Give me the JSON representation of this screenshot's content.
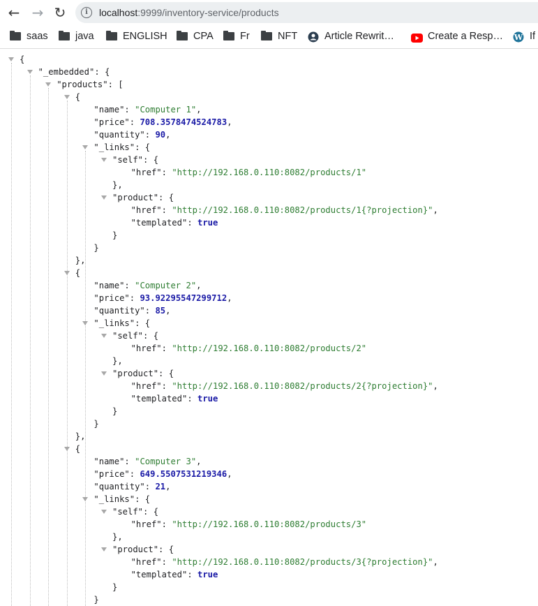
{
  "browser": {
    "nav": {
      "back_icon": "←",
      "forward_icon": "→",
      "reload_icon": "↻"
    },
    "url": {
      "host": "localhost",
      "rest": ":9999/inventory-service/products"
    },
    "bookmarks": [
      {
        "label": "saas",
        "icon": "folder-icon"
      },
      {
        "label": "java",
        "icon": "folder-icon"
      },
      {
        "label": "ENGLISH",
        "icon": "folder-icon"
      },
      {
        "label": "CPA",
        "icon": "folder-icon"
      },
      {
        "label": "Fr",
        "icon": "folder-icon"
      },
      {
        "label": "NFT",
        "icon": "folder-icon"
      },
      {
        "label": "Article Rewrit…",
        "icon": "article-rewriter-icon"
      },
      {
        "label": "Create a Resp…",
        "icon": "youtube-icon"
      },
      {
        "label": "If",
        "icon": "wordpress-icon"
      }
    ]
  },
  "json_lines": [
    {
      "indent": 0,
      "arrow": true,
      "tokens": [
        [
          "p",
          "{"
        ]
      ]
    },
    {
      "indent": 1,
      "arrow": true,
      "tokens": [
        [
          "k",
          "\"_embedded\""
        ],
        [
          "p",
          ": {"
        ]
      ]
    },
    {
      "indent": 2,
      "arrow": true,
      "tokens": [
        [
          "k",
          "\"products\""
        ],
        [
          "p",
          ": ["
        ]
      ]
    },
    {
      "indent": 3,
      "arrow": true,
      "tokens": [
        [
          "p",
          "{"
        ]
      ]
    },
    {
      "indent": 4,
      "arrow": false,
      "tokens": [
        [
          "k",
          "\"name\""
        ],
        [
          "p",
          ": "
        ],
        [
          "s",
          "\"Computer 1\""
        ],
        [
          "p",
          ","
        ]
      ]
    },
    {
      "indent": 4,
      "arrow": false,
      "tokens": [
        [
          "k",
          "\"price\""
        ],
        [
          "p",
          ": "
        ],
        [
          "n",
          "708.3578474524783"
        ],
        [
          "p",
          ","
        ]
      ]
    },
    {
      "indent": 4,
      "arrow": false,
      "tokens": [
        [
          "k",
          "\"quantity\""
        ],
        [
          "p",
          ": "
        ],
        [
          "n",
          "90"
        ],
        [
          "p",
          ","
        ]
      ]
    },
    {
      "indent": 4,
      "arrow": true,
      "tokens": [
        [
          "k",
          "\"_links\""
        ],
        [
          "p",
          ": {"
        ]
      ]
    },
    {
      "indent": 5,
      "arrow": true,
      "tokens": [
        [
          "k",
          "\"self\""
        ],
        [
          "p",
          ": {"
        ]
      ]
    },
    {
      "indent": 6,
      "arrow": false,
      "tokens": [
        [
          "k",
          "\"href\""
        ],
        [
          "p",
          ": "
        ],
        [
          "s",
          "\"http://192.168.0.110:8082/products/1\""
        ]
      ]
    },
    {
      "indent": 5,
      "arrow": false,
      "tokens": [
        [
          "p",
          "},"
        ]
      ]
    },
    {
      "indent": 5,
      "arrow": true,
      "tokens": [
        [
          "k",
          "\"product\""
        ],
        [
          "p",
          ": {"
        ]
      ]
    },
    {
      "indent": 6,
      "arrow": false,
      "tokens": [
        [
          "k",
          "\"href\""
        ],
        [
          "p",
          ": "
        ],
        [
          "s",
          "\"http://192.168.0.110:8082/products/1{?projection}\""
        ],
        [
          "p",
          ","
        ]
      ]
    },
    {
      "indent": 6,
      "arrow": false,
      "tokens": [
        [
          "k",
          "\"templated\""
        ],
        [
          "p",
          ": "
        ],
        [
          "b",
          "true"
        ]
      ]
    },
    {
      "indent": 5,
      "arrow": false,
      "tokens": [
        [
          "p",
          "}"
        ]
      ]
    },
    {
      "indent": 4,
      "arrow": false,
      "tokens": [
        [
          "p",
          "}"
        ]
      ]
    },
    {
      "indent": 3,
      "arrow": false,
      "tokens": [
        [
          "p",
          "},"
        ]
      ]
    },
    {
      "indent": 3,
      "arrow": true,
      "tokens": [
        [
          "p",
          "{"
        ]
      ]
    },
    {
      "indent": 4,
      "arrow": false,
      "tokens": [
        [
          "k",
          "\"name\""
        ],
        [
          "p",
          ": "
        ],
        [
          "s",
          "\"Computer 2\""
        ],
        [
          "p",
          ","
        ]
      ]
    },
    {
      "indent": 4,
      "arrow": false,
      "tokens": [
        [
          "k",
          "\"price\""
        ],
        [
          "p",
          ": "
        ],
        [
          "n",
          "93.92295547299712"
        ],
        [
          "p",
          ","
        ]
      ]
    },
    {
      "indent": 4,
      "arrow": false,
      "tokens": [
        [
          "k",
          "\"quantity\""
        ],
        [
          "p",
          ": "
        ],
        [
          "n",
          "85"
        ],
        [
          "p",
          ","
        ]
      ]
    },
    {
      "indent": 4,
      "arrow": true,
      "tokens": [
        [
          "k",
          "\"_links\""
        ],
        [
          "p",
          ": {"
        ]
      ]
    },
    {
      "indent": 5,
      "arrow": true,
      "tokens": [
        [
          "k",
          "\"self\""
        ],
        [
          "p",
          ": {"
        ]
      ]
    },
    {
      "indent": 6,
      "arrow": false,
      "tokens": [
        [
          "k",
          "\"href\""
        ],
        [
          "p",
          ": "
        ],
        [
          "s",
          "\"http://192.168.0.110:8082/products/2\""
        ]
      ]
    },
    {
      "indent": 5,
      "arrow": false,
      "tokens": [
        [
          "p",
          "},"
        ]
      ]
    },
    {
      "indent": 5,
      "arrow": true,
      "tokens": [
        [
          "k",
          "\"product\""
        ],
        [
          "p",
          ": {"
        ]
      ]
    },
    {
      "indent": 6,
      "arrow": false,
      "tokens": [
        [
          "k",
          "\"href\""
        ],
        [
          "p",
          ": "
        ],
        [
          "s",
          "\"http://192.168.0.110:8082/products/2{?projection}\""
        ],
        [
          "p",
          ","
        ]
      ]
    },
    {
      "indent": 6,
      "arrow": false,
      "tokens": [
        [
          "k",
          "\"templated\""
        ],
        [
          "p",
          ": "
        ],
        [
          "b",
          "true"
        ]
      ]
    },
    {
      "indent": 5,
      "arrow": false,
      "tokens": [
        [
          "p",
          "}"
        ]
      ]
    },
    {
      "indent": 4,
      "arrow": false,
      "tokens": [
        [
          "p",
          "}"
        ]
      ]
    },
    {
      "indent": 3,
      "arrow": false,
      "tokens": [
        [
          "p",
          "},"
        ]
      ]
    },
    {
      "indent": 3,
      "arrow": true,
      "tokens": [
        [
          "p",
          "{"
        ]
      ]
    },
    {
      "indent": 4,
      "arrow": false,
      "tokens": [
        [
          "k",
          "\"name\""
        ],
        [
          "p",
          ": "
        ],
        [
          "s",
          "\"Computer 3\""
        ],
        [
          "p",
          ","
        ]
      ]
    },
    {
      "indent": 4,
      "arrow": false,
      "tokens": [
        [
          "k",
          "\"price\""
        ],
        [
          "p",
          ": "
        ],
        [
          "n",
          "649.5507531219346"
        ],
        [
          "p",
          ","
        ]
      ]
    },
    {
      "indent": 4,
      "arrow": false,
      "tokens": [
        [
          "k",
          "\"quantity\""
        ],
        [
          "p",
          ": "
        ],
        [
          "n",
          "21"
        ],
        [
          "p",
          ","
        ]
      ]
    },
    {
      "indent": 4,
      "arrow": true,
      "tokens": [
        [
          "k",
          "\"_links\""
        ],
        [
          "p",
          ": {"
        ]
      ]
    },
    {
      "indent": 5,
      "arrow": true,
      "tokens": [
        [
          "k",
          "\"self\""
        ],
        [
          "p",
          ": {"
        ]
      ]
    },
    {
      "indent": 6,
      "arrow": false,
      "tokens": [
        [
          "k",
          "\"href\""
        ],
        [
          "p",
          ": "
        ],
        [
          "s",
          "\"http://192.168.0.110:8082/products/3\""
        ]
      ]
    },
    {
      "indent": 5,
      "arrow": false,
      "tokens": [
        [
          "p",
          "},"
        ]
      ]
    },
    {
      "indent": 5,
      "arrow": true,
      "tokens": [
        [
          "k",
          "\"product\""
        ],
        [
          "p",
          ": {"
        ]
      ]
    },
    {
      "indent": 6,
      "arrow": false,
      "tokens": [
        [
          "k",
          "\"href\""
        ],
        [
          "p",
          ": "
        ],
        [
          "s",
          "\"http://192.168.0.110:8082/products/3{?projection}\""
        ],
        [
          "p",
          ","
        ]
      ]
    },
    {
      "indent": 6,
      "arrow": false,
      "tokens": [
        [
          "k",
          "\"templated\""
        ],
        [
          "p",
          ": "
        ],
        [
          "b",
          "true"
        ]
      ]
    },
    {
      "indent": 5,
      "arrow": false,
      "tokens": [
        [
          "p",
          "}"
        ]
      ]
    },
    {
      "indent": 4,
      "arrow": false,
      "tokens": [
        [
          "p",
          "}"
        ]
      ]
    }
  ]
}
